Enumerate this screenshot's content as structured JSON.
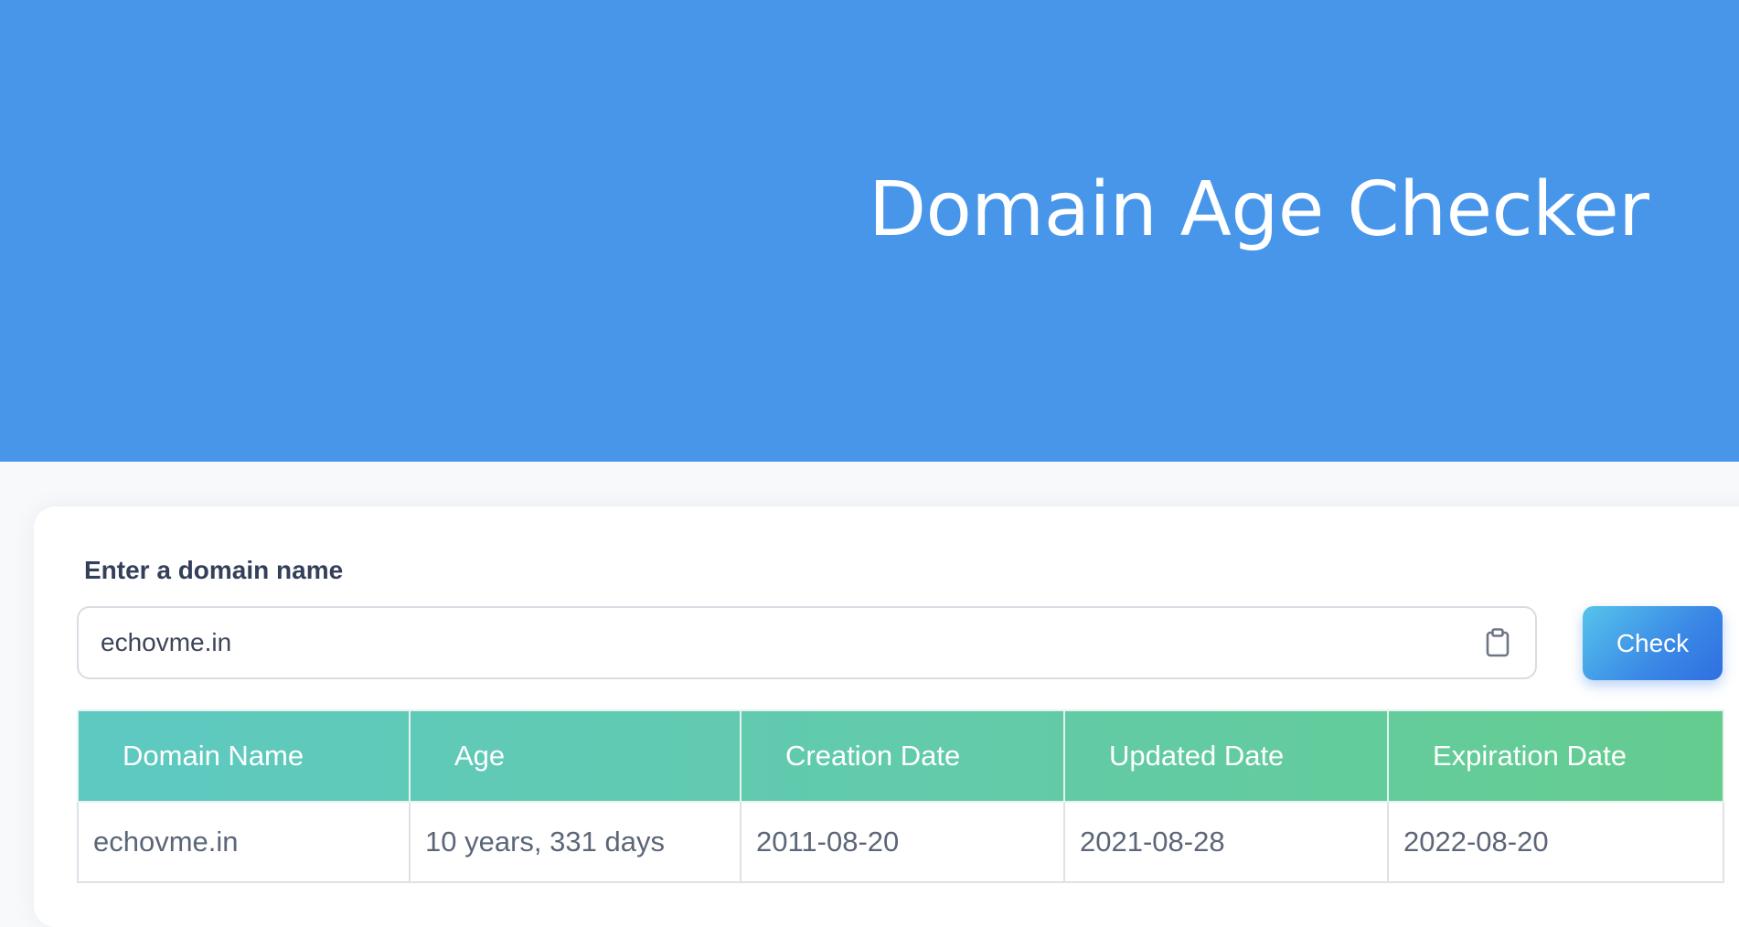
{
  "hero": {
    "title": "Domain Age Checker",
    "background_color": "#4796ea"
  },
  "form": {
    "label": "Enter a domain name",
    "input_value": "echovme.in",
    "clipboard_icon": "clipboard-icon",
    "check_label": "Check"
  },
  "table": {
    "headers": [
      "Domain Name",
      "Age",
      "Creation Date",
      "Updated Date",
      "Expiration Date"
    ],
    "rows": [
      [
        "echovme.in",
        "10 years, 331 days",
        "2011-08-20",
        "2021-08-28",
        "2022-08-20"
      ]
    ],
    "header_gradient": [
      "#5ec9c1",
      "#64cc8f"
    ]
  }
}
